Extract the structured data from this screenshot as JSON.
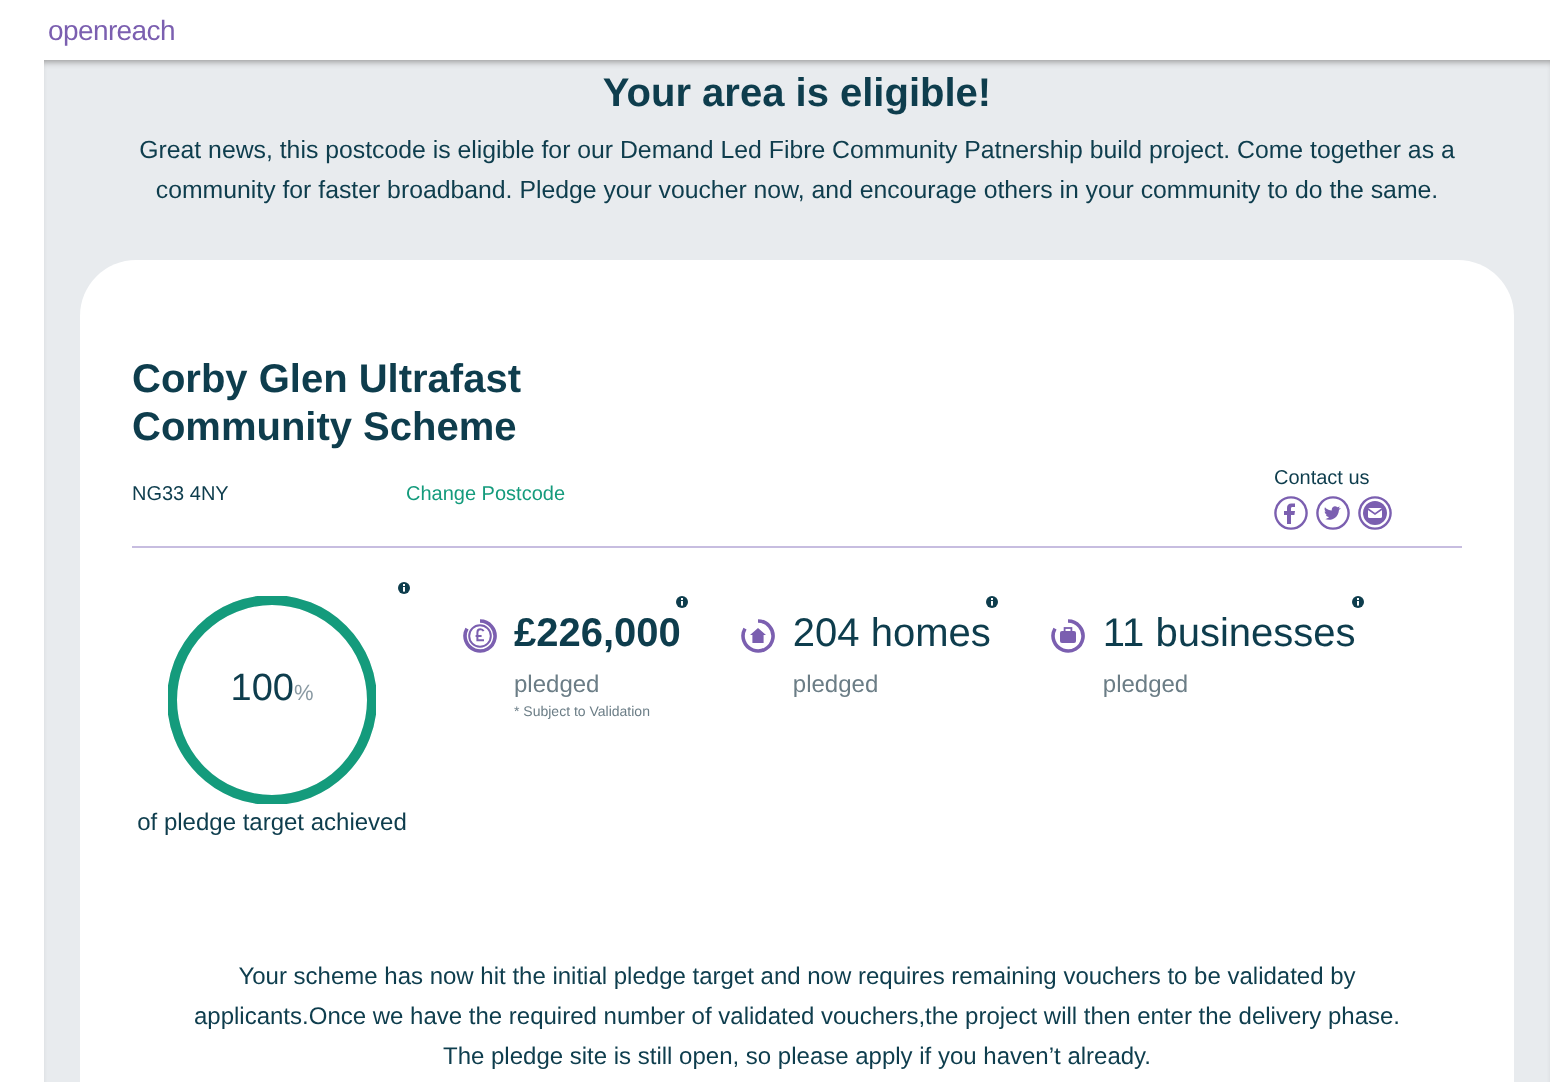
{
  "brand": "openreach",
  "heading": "Your area is eligible!",
  "intro": "Great news, this postcode is eligible for our Demand Led Fibre Community Patnership build project. Come together as a community for faster broadband. Pledge your voucher now, and encourage others in your community to do the same.",
  "scheme": {
    "title_lines": [
      "Corby Glen Ultrafast",
      "Community Scheme"
    ],
    "postcode": "NG33 4NY",
    "change_link": "Change Postcode",
    "contact_label": "Contact us",
    "contact_icons": [
      {
        "kind": "facebook"
      },
      {
        "kind": "twitter"
      },
      {
        "kind": "email"
      }
    ]
  },
  "progress": {
    "value": "100",
    "unit": "%",
    "level": 1,
    "caption": "of pledge target achieved"
  },
  "stats": [
    {
      "kind": "money",
      "value": "£226,000",
      "label": "pledged",
      "note": "* Subject to Validation",
      "bold": true
    },
    {
      "kind": "homes",
      "value": "204 homes",
      "label": "pledged",
      "bold": false
    },
    {
      "kind": "businesses",
      "value": "11 businesses",
      "label": "pledged",
      "bold": false
    }
  ],
  "message": "Your scheme has now hit the initial pledge target and now requires remaining vouchers to be validated by applicants.Once we have the required number of validated vouchers,the project will then enter the delivery phase. The pledge site is still open, so please apply if you haven’t already."
}
